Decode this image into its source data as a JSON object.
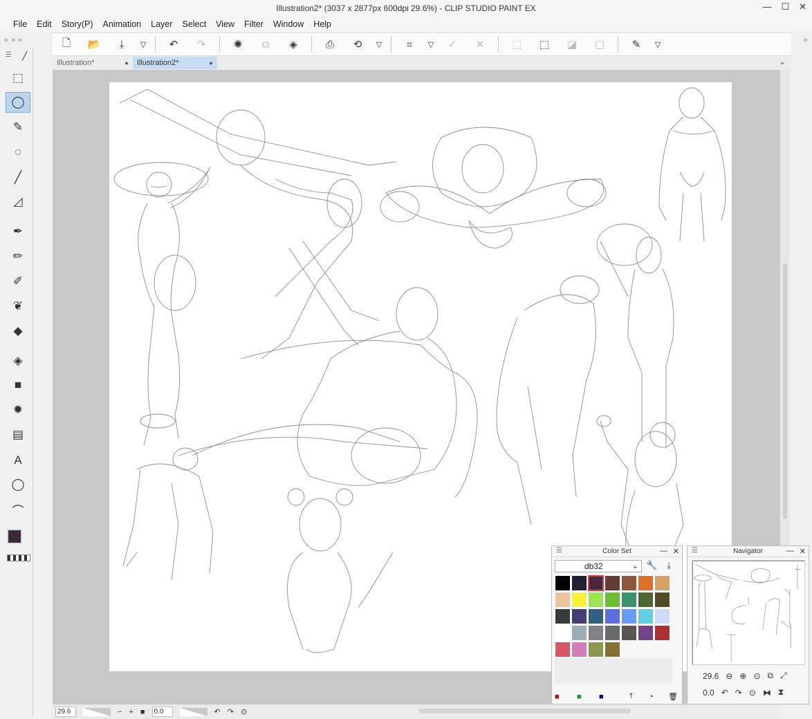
{
  "window": {
    "title": "Illustration2* (3037 x 2877px 600dpi 29.6%)  - CLIP STUDIO PAINT EX",
    "controls": [
      "—",
      "☐",
      "✕"
    ]
  },
  "menu": [
    "File",
    "Edit",
    "Story(P)",
    "Animation",
    "Layer",
    "Select",
    "View",
    "Filter",
    "Window",
    "Help"
  ],
  "tabs": [
    {
      "label": "Illustration*",
      "active": false
    },
    {
      "label": "Illustration2*",
      "active": true
    }
  ],
  "tools": [
    {
      "name": "operation-icon",
      "glyph": "⬚"
    },
    {
      "name": "lasso-icon",
      "glyph": "◯"
    },
    {
      "name": "eyedropper-icon",
      "glyph": "✎"
    },
    {
      "name": "selection-brush-icon",
      "glyph": "◌"
    },
    {
      "name": "pen-icon",
      "glyph": "╱"
    },
    {
      "name": "ruler-icon",
      "glyph": "◿"
    },
    {
      "name": "pen-nib-icon",
      "glyph": "✒"
    },
    {
      "name": "pencil-icon",
      "glyph": "✏"
    },
    {
      "name": "brush-icon",
      "glyph": "✐"
    },
    {
      "name": "blend-icon",
      "glyph": "❦"
    },
    {
      "name": "eraser-icon",
      "glyph": "◆"
    },
    {
      "name": "fill-icon",
      "glyph": "◈"
    },
    {
      "name": "gradient-icon",
      "glyph": "■"
    },
    {
      "name": "figure-icon",
      "glyph": "✹"
    },
    {
      "name": "frame-icon",
      "glyph": "▤"
    },
    {
      "name": "text-icon",
      "glyph": "A"
    },
    {
      "name": "balloon-icon",
      "glyph": "◯"
    },
    {
      "name": "line-icon",
      "glyph": "⌒"
    }
  ],
  "colors": {
    "main": "#3f2733",
    "sub": "#000000",
    "accent_tab": "#c6dcf4"
  },
  "color_set": {
    "title": "Color Set",
    "set_name": "db32",
    "swatches": [
      "#000000",
      "#222034",
      "#45283c",
      "#663931",
      "#8f563b",
      "#df7126",
      "#d9a066",
      "#eec39a",
      "#fbf236",
      "#99e550",
      "#6abe30",
      "#37946e",
      "#4b692f",
      "#524b24",
      "#323c39",
      "#3f3f74",
      "#306082",
      "#5b6ee1",
      "#639bff",
      "#5fcde4",
      "#cbdbfc",
      "#ffffff",
      "#9badb7",
      "#847e87",
      "#696a6a",
      "#595652",
      "#76428a",
      "#ac3232",
      "#d95763",
      "#d77bba",
      "#8f974a",
      "#8a6f30"
    ],
    "selected_index": 2
  },
  "navigator": {
    "title": "Navigator",
    "zoom": "29.6",
    "rotation": "0.0"
  },
  "status": {
    "zoom": "29.6",
    "rotation": "0.0"
  }
}
